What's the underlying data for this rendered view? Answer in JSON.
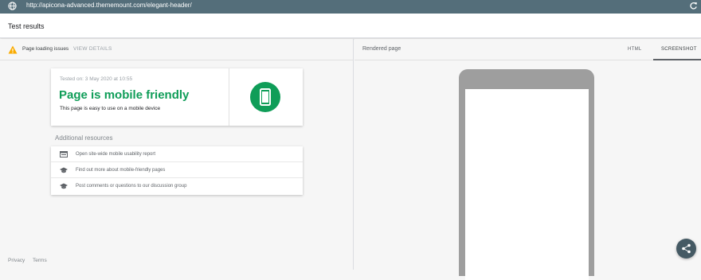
{
  "browser": {
    "url": "http://apicona-advanced.thememount.com/elegant-header/",
    "globe_icon": "globe-icon",
    "reload_icon": "reload-icon"
  },
  "header": {
    "title": "Test results"
  },
  "issues": {
    "label": "Page loading issues",
    "details_link": "VIEW DETAILS",
    "icon": "warning-icon",
    "warning_color": "#f9ab00"
  },
  "result": {
    "tested_on": "Tested on: 3 May 2020 at 10:55",
    "verdict": "Page is mobile friendly",
    "description": "This page is easy to use on a mobile device",
    "verdict_color": "#0f9d58",
    "badge_icon": "mobile-phone-icon"
  },
  "resources": {
    "title": "Additional resources",
    "items": [
      {
        "label": "Open site-wide mobile usability report",
        "icon": "report-icon"
      },
      {
        "label": "Find out more about mobile-friendly pages",
        "icon": "graduation-cap-icon"
      },
      {
        "label": "Post comments or questions to our discussion group",
        "icon": "graduation-cap-icon"
      }
    ]
  },
  "footer": {
    "privacy": "Privacy",
    "terms": "Terms"
  },
  "rendered": {
    "label": "Rendered page",
    "tabs": [
      {
        "label": "HTML",
        "active": false
      },
      {
        "label": "SCREENSHOT",
        "active": true
      }
    ]
  },
  "fab": {
    "icon": "share-icon"
  }
}
